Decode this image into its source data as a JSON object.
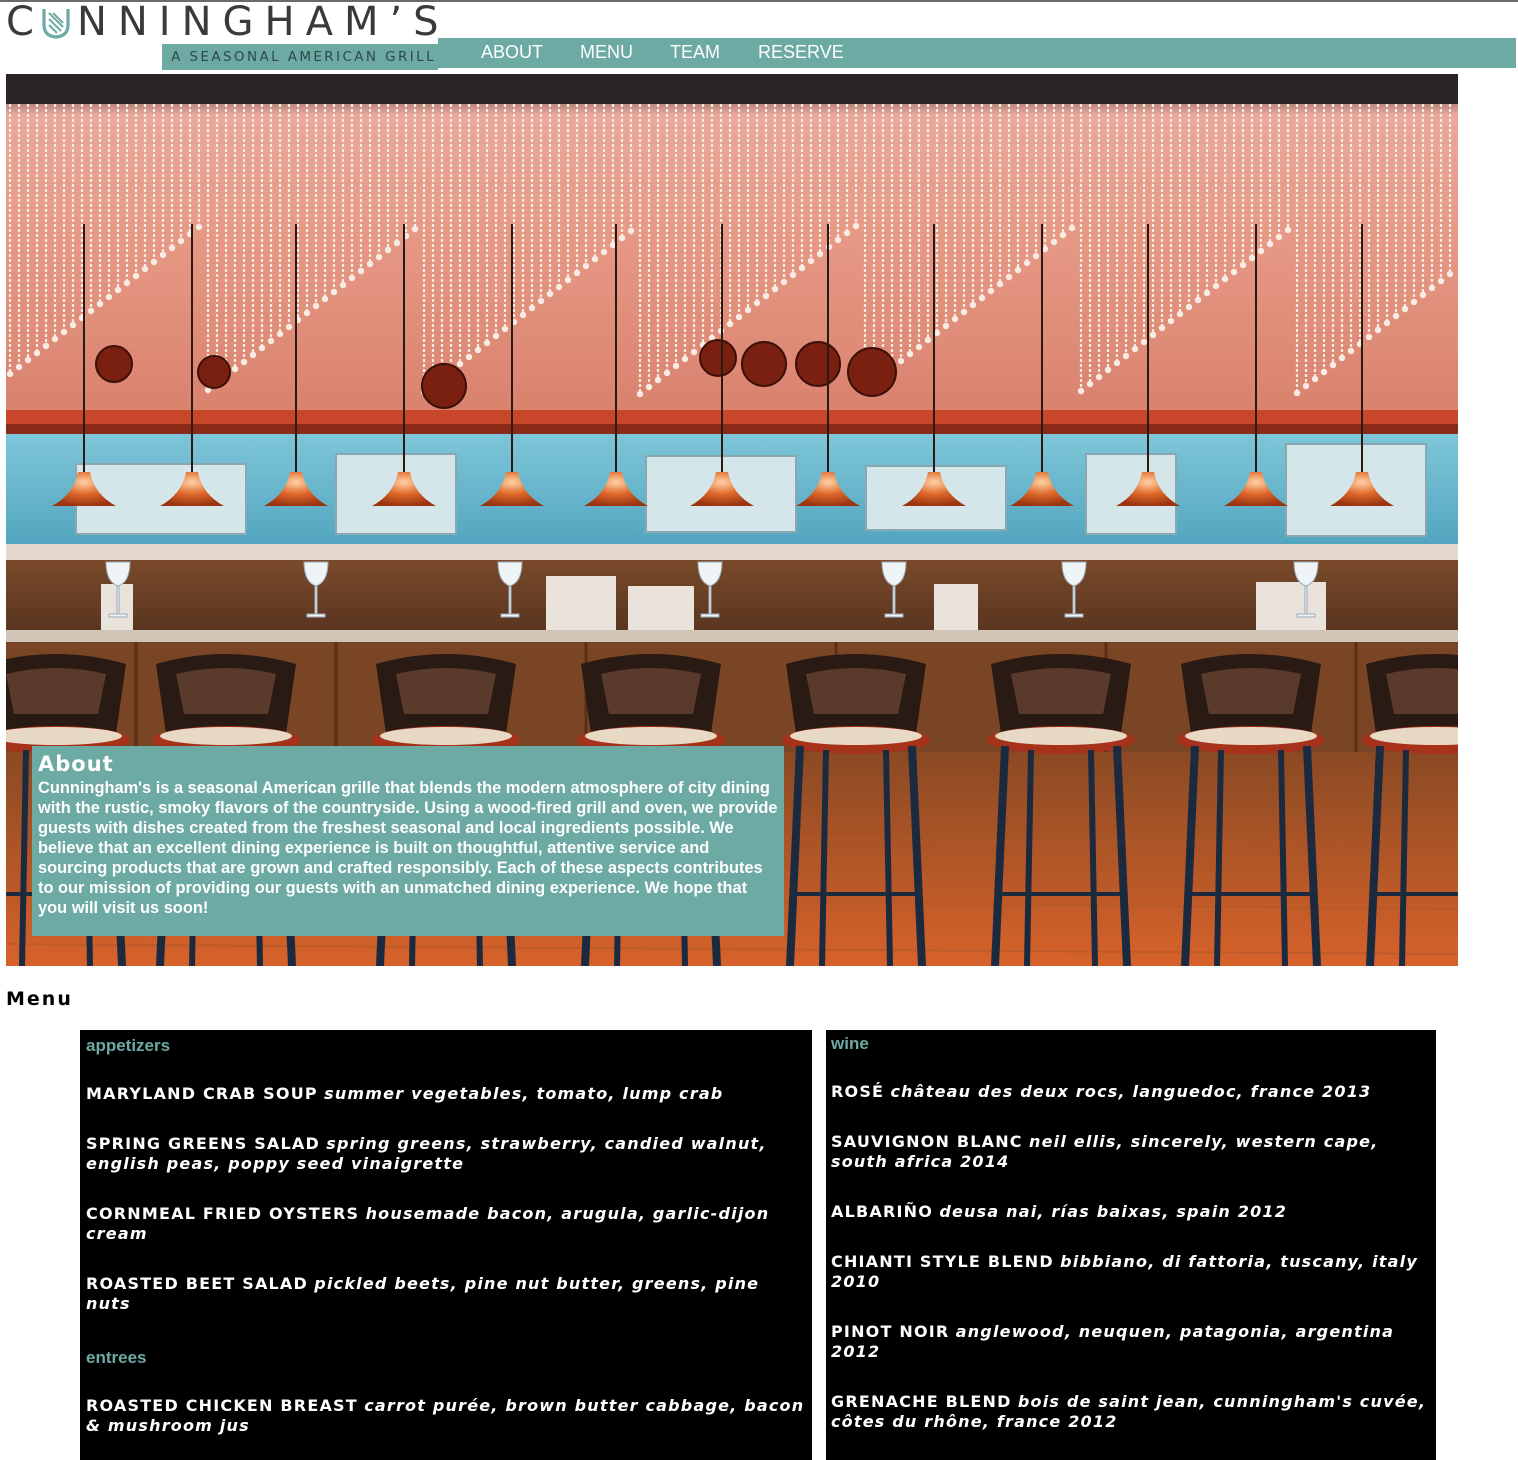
{
  "brand": {
    "name_parts": [
      "C",
      "NNINGHAM’S"
    ],
    "tagline": "A SEASONAL AMERICAN GRILL",
    "accent_color": "#6daaa3"
  },
  "nav": {
    "items": [
      {
        "label": "ABOUT"
      },
      {
        "label": "MENU"
      },
      {
        "label": "TEAM"
      },
      {
        "label": "RESERVE"
      }
    ]
  },
  "about": {
    "title": "About",
    "body": "Cunningham's is a seasonal American grille that blends the modern atmosphere of city dining with the rustic, smoky flavors of the countryside. Using a wood-fired grill and oven, we provide guests with dishes created from the freshest seasonal and local ingredients possible. We believe that an excellent dining experience is built on thoughtful, attentive service and sourcing products that are grown and crafted responsibly. Each of these aspects contributes to our mission of providing our guests with an unmatched dining experience. We hope that you will visit us soon!"
  },
  "menu": {
    "heading": "Menu",
    "appetizers": {
      "label": "appetizers",
      "items": [
        {
          "name": "MARYLAND CRAB SOUP",
          "desc": "summer vegetables, tomato, lump crab"
        },
        {
          "name": "SPRING GREENS SALAD",
          "desc": "spring greens, strawberry, candied walnut, english peas, poppy seed vinaigrette"
        },
        {
          "name": "CORNMEAL FRIED OYSTERS",
          "desc": "housemade bacon, arugula, garlic-dijon cream"
        },
        {
          "name": "ROASTED BEET SALAD",
          "desc": "pickled beets, pine nut butter, greens, pine nuts"
        }
      ]
    },
    "entrees": {
      "label": "entrees",
      "items": [
        {
          "name": "ROASTED CHICKEN BREAST",
          "desc": "carrot purée, brown butter cabbage, bacon & mushroom jus"
        }
      ]
    },
    "wine": {
      "label": "wine",
      "items": [
        {
          "name": "ROSÉ",
          "desc": "château des deux rocs, languedoc, france 2013"
        },
        {
          "name": "SAUVIGNON BLANC",
          "desc": "neil ellis, sincerely, western cape, south africa 2014"
        },
        {
          "name": "ALBARIÑO",
          "desc": "deusa nai, rías baixas, spain 2012"
        },
        {
          "name": "CHIANTI STYLE BLEND",
          "desc": "bibbiano, di fattoria, tuscany, italy 2010"
        },
        {
          "name": "PINOT NOIR",
          "desc": "anglewood, neuquen, patagonia, argentina 2012"
        },
        {
          "name": "GRENACHE BLEND",
          "desc": "bois de saint jean, cunningham's cuvée, côtes du rhône, france 2012"
        }
      ]
    }
  }
}
